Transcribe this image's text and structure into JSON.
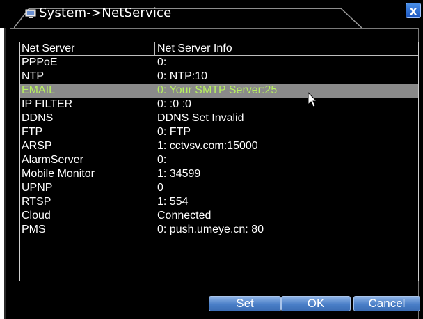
{
  "window": {
    "title": "System->NetService",
    "close_glyph": "x"
  },
  "table": {
    "headers": [
      "Net Server",
      "Net Server Info"
    ],
    "rows": [
      {
        "name": "PPPoE",
        "info": "0:"
      },
      {
        "name": "NTP",
        "info": "0: NTP:10"
      },
      {
        "name": "EMAIL",
        "info": "0: Your SMTP Server:25",
        "selected": true
      },
      {
        "name": "IP FILTER",
        "info": "0: :0 :0"
      },
      {
        "name": "DDNS",
        "info": "DDNS Set Invalid"
      },
      {
        "name": "FTP",
        "info": "0: FTP"
      },
      {
        "name": "ARSP",
        "info": "1: cctvsv.com:15000"
      },
      {
        "name": "AlarmServer",
        "info": "0:"
      },
      {
        "name": "Mobile Monitor",
        "info": "1: 34599"
      },
      {
        "name": "UPNP",
        "info": "0"
      },
      {
        "name": "RTSP",
        "info": "1: 554"
      },
      {
        "name": "Cloud",
        "info": "Connected"
      },
      {
        "name": "PMS",
        "info": "0: push.umeye.cn: 80"
      }
    ]
  },
  "buttons": {
    "set": "Set",
    "ok": "OK",
    "cancel": "Cancel"
  },
  "colors": {
    "selected_row_bg": "#8a8a8a",
    "selected_row_text": "#b7f060",
    "button_blue": "#4a7fc8"
  }
}
